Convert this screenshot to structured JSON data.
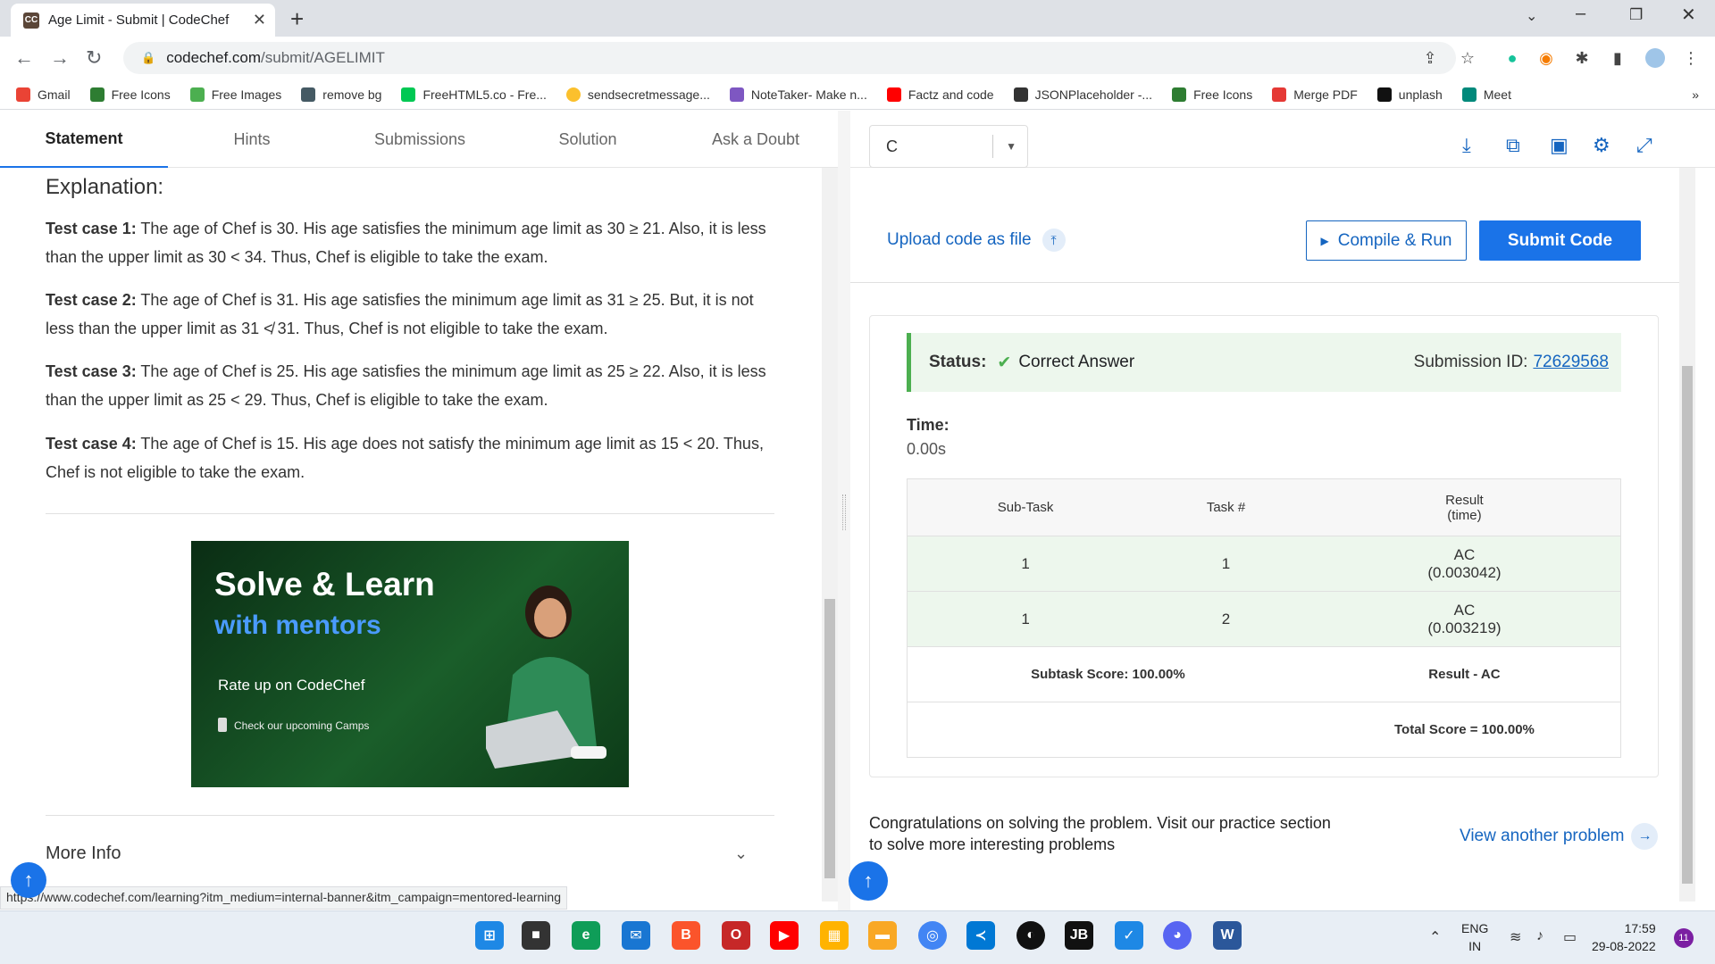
{
  "browser": {
    "tab_title": "Age Limit - Submit | CodeChef",
    "tab_favicon": "CC",
    "url_host": "codechef.com",
    "url_path": "/submit/AGELIMIT",
    "bookmarks": [
      {
        "label": "Gmail",
        "color": "#ea4335"
      },
      {
        "label": "Free Icons",
        "color": "#2e7d32"
      },
      {
        "label": "Free Images",
        "color": "#4caf50"
      },
      {
        "label": "remove bg",
        "color": "#455a64"
      },
      {
        "label": "FreeHTML5.co - Fre...",
        "color": "#00c853"
      },
      {
        "label": "sendsecretmessage...",
        "color": "#fbc02d"
      },
      {
        "label": "NoteTaker- Make n...",
        "color": "#7e57c2"
      },
      {
        "label": "Factz and code",
        "color": "#ff0000"
      },
      {
        "label": "JSONPlaceholder -...",
        "color": "#333333"
      },
      {
        "label": "Free Icons",
        "color": "#2e7d32"
      },
      {
        "label": "Merge PDF",
        "color": "#e53935"
      },
      {
        "label": "unplash",
        "color": "#111111"
      },
      {
        "label": "Meet",
        "color": "#00897b"
      }
    ]
  },
  "problem": {
    "tabs": [
      "Statement",
      "Hints",
      "Submissions",
      "Solution",
      "Ask a Doubt"
    ],
    "active_tab": "Statement",
    "explanation_heading": "Explanation:",
    "test_cases": [
      {
        "label": "Test case 1:",
        "text": "The age of Chef is 30. His age satisfies the minimum age limit as 30 ≥ 21. Also, it is less than the upper limit as 30 < 34. Thus, Chef is eligible to take the exam."
      },
      {
        "label": "Test case 2:",
        "text": "The age of Chef is 31. His age satisfies the minimum age limit as 31 ≥ 25. But, it is not less than the upper limit as 31 ≮ 31. Thus, Chef is not eligible to take the exam."
      },
      {
        "label": "Test case 3:",
        "text": "The age of Chef is 25. His age satisfies the minimum age limit as 25 ≥ 22. Also, it is less than the upper limit as 25 < 29. Thus, Chef is eligible to take the exam."
      },
      {
        "label": "Test case 4:",
        "text": "The age of Chef is 15. His age does not satisfy the minimum age limit as 15 < 20. Thus, Chef is not eligible to take the exam."
      }
    ],
    "banner": {
      "line1": "Solve & Learn",
      "line2": "with mentors",
      "line3": "Rate up on CodeChef",
      "line4": "Check our upcoming Camps"
    },
    "more_info": "More Info",
    "status_url": "https://www.codechef.com/learning?itm_medium=internal-banner&itm_campaign=mentored-learning"
  },
  "editor": {
    "language": "C",
    "upload_label": "Upload code as file",
    "compile_label": "Compile & Run",
    "submit_label": "Submit Code"
  },
  "result": {
    "status_label": "Status:",
    "status_value": "Correct Answer",
    "submission_id_label": "Submission ID:",
    "submission_id": "72629568",
    "time_label": "Time:",
    "time_value": "0.00s",
    "table_headers": [
      "Sub-Task",
      "Task #",
      "Result",
      "(time)"
    ],
    "rows": [
      {
        "subtask": "1",
        "task": "1",
        "result": "AC",
        "time": "(0.003042)"
      },
      {
        "subtask": "1",
        "task": "2",
        "result": "AC",
        "time": "(0.003219)"
      }
    ],
    "subtask_score": "Subtask Score: 100.00%",
    "result_summary": "Result - AC",
    "total_score": "Total Score = 100.00%",
    "congrats": "Congratulations on solving the problem. Visit our practice section to solve more interesting problems",
    "view_another": "View another problem"
  },
  "taskbar": {
    "lang_line1": "ENG",
    "lang_line2": "IN",
    "time": "17:59",
    "date": "29-08-2022",
    "notif_badge": "11"
  },
  "colors": {
    "accent": "#1a73e8",
    "success": "#4caf50",
    "success_bg": "#edf7ed",
    "link": "#1565c0"
  }
}
